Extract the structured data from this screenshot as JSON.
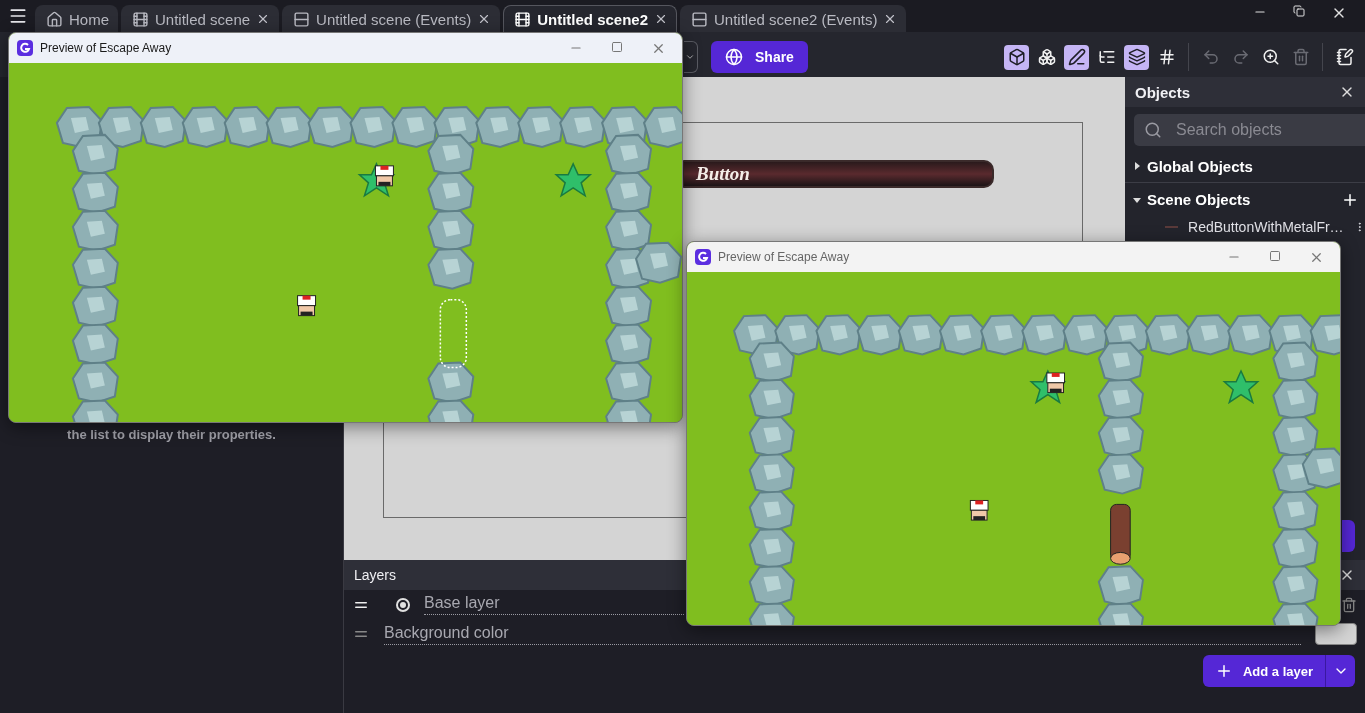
{
  "tabs_bar": {
    "tabs": [
      {
        "label": "Home",
        "kind": "home",
        "selected": false
      },
      {
        "label": "Untitled scene",
        "kind": "scene",
        "selected": false
      },
      {
        "label": "Untitled scene (Events)",
        "kind": "events",
        "selected": false
      },
      {
        "label": "Untitled scene2",
        "kind": "scene",
        "selected": true
      },
      {
        "label": "Untitled scene2 (Events)",
        "kind": "events",
        "selected": false
      }
    ]
  },
  "toolbar": {
    "share_button": "Share",
    "tools": [
      {
        "selected": true,
        "disabled": false
      },
      {
        "selected": false,
        "disabled": false
      },
      {
        "selected": true,
        "disabled": false
      },
      {
        "selected": false,
        "disabled": false
      },
      {
        "selected": true,
        "disabled": false
      },
      {
        "selected": false,
        "disabled": false
      },
      {
        "selected": false,
        "disabled": true
      },
      {
        "selected": false,
        "disabled": true
      },
      {
        "selected": false,
        "disabled": false
      },
      {
        "selected": false,
        "disabled": true
      },
      {
        "selected": false,
        "disabled": false
      }
    ]
  },
  "left_panel": {
    "hint": "the list to display their properties."
  },
  "scene_canvas": {
    "sprite_text": "Button"
  },
  "objects_panel": {
    "title": "Objects",
    "search": {
      "placeholder": "Search objects"
    },
    "groups": [
      {
        "label": "Global Objects",
        "expanded": false
      },
      {
        "label": "Scene Objects",
        "expanded": true,
        "items": [
          {
            "name": "RedButtonWithMetalFr…"
          }
        ]
      }
    ]
  },
  "layers_panel": {
    "title": "Layers",
    "layers": [
      {
        "name": "Base layer",
        "selected": true
      }
    ],
    "background": {
      "label": "Background color",
      "color": "#d4d4d4"
    },
    "add_button": "Add a layer"
  },
  "previews": [
    {
      "title": "Preview of Escape Away"
    },
    {
      "title": "Preview of Escape Away"
    }
  ]
}
